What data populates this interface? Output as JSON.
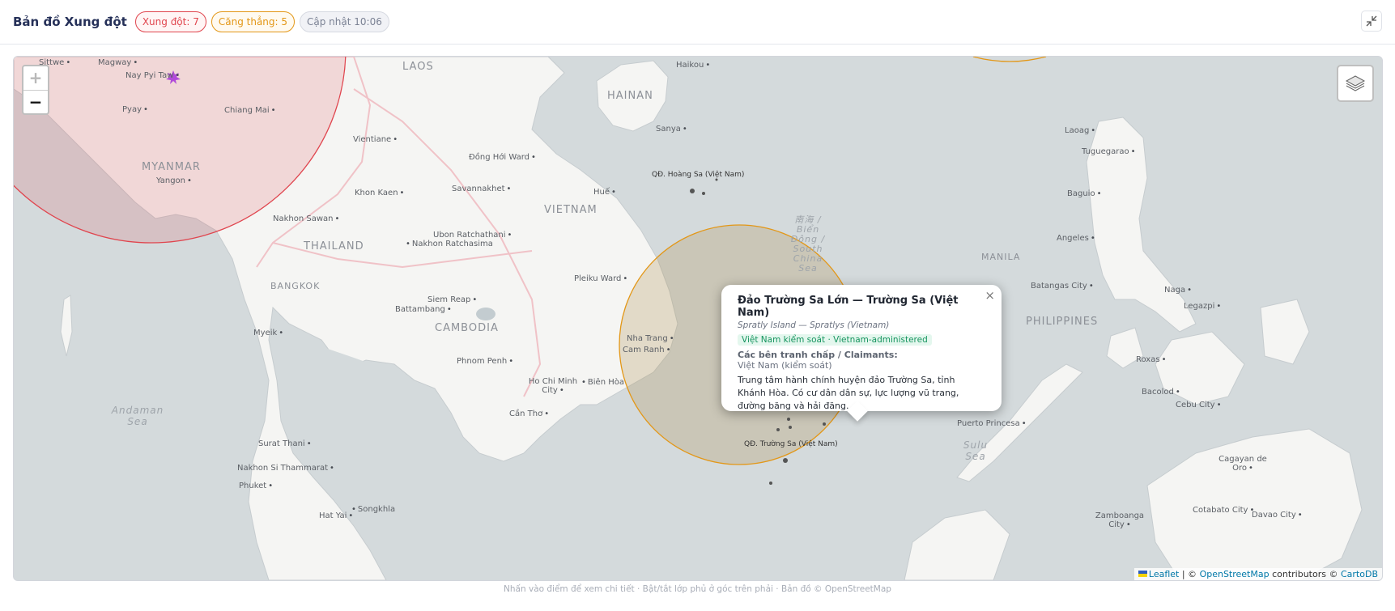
{
  "header": {
    "title": "Bản đồ Xung đột",
    "conflict_badge": "Xung đột: 7",
    "tension_badge": "Căng thẳng: 5",
    "update_badge": "Cập nhật 10:06"
  },
  "map": {
    "zoom_in": "+",
    "zoom_out": "−",
    "countries": {
      "laos": "LAOS",
      "hainan": "HAINAN",
      "myanmar": "MYANMAR",
      "vietnam": "VIETNAM",
      "thailand": "THAILAND",
      "cambodia": "CAMBODIA",
      "philippines": "PHILIPPINES",
      "manila": "MANILA",
      "bangkok": "BANGKOK"
    },
    "seas": {
      "andaman": "Andaman Sea",
      "sulu": "Sulu Sea",
      "scs": "南海 / Biển Đông / South China Sea"
    },
    "cities": {
      "sittwe": "Sittwe",
      "magway": "Magway",
      "naypyitaw": "Nay Pyi Taw",
      "pyay": "Pyay",
      "chiangmai": "Chiang Mai",
      "yangon": "Yangon",
      "vientiane": "Vientiane",
      "donghoi": "Đồng Hới Ward",
      "khonkaen": "Khon Kaen",
      "savannakhet": "Savannakhet",
      "hue": "Huế",
      "nakhonsawan": "Nakhon Sawan",
      "ubon": "Ubon Ratchathani",
      "nakhonratchasima": "Nakhon Ratchasima",
      "pleiku": "Pleiku Ward",
      "siemreap": "Siem Reap",
      "battambang": "Battambang",
      "myeik": "Myeik",
      "nhatrang": "Nha Trang",
      "camranh": "Cam Ranh",
      "phnompenh": "Phnom Penh",
      "hcm": "Ho Chi Minh City",
      "bienhoa": "Biên Hòa",
      "cantho": "Cần Thơ",
      "suratthani": "Surat Thani",
      "nakhonsi": "Nakhon Si Thammarat",
      "phuket": "Phuket",
      "songkhla": "Songkhla",
      "hatyai": "Hat Yai",
      "haikou": "Haikou",
      "sanya": "Sanya",
      "laoag": "Laoag",
      "tuguegarao": "Tuguegarao",
      "baguio": "Baguio",
      "angeles": "Angeles",
      "batangas": "Batangas City",
      "naga": "Naga",
      "legazpi": "Legazpi",
      "roxas": "Roxas",
      "bacolod": "Bacolod",
      "cebu": "Cebu City",
      "puertoprincesa": "Puerto Princesa",
      "cagayan": "Cagayan de Oro",
      "cotabato": "Cotabato City",
      "davao": "Davao City",
      "zamboanga": "Zamboanga City"
    },
    "archipelagos": {
      "paracel": "QĐ. Hoàng Sa (Việt Nam)",
      "spratly": "QĐ. Trường Sa (Việt Nam)"
    },
    "colors": {
      "conflict_zone": "#e0454e",
      "tension_zone": "#e39717",
      "sea": "#d4dadc",
      "land": "#f5f5f3"
    }
  },
  "popup": {
    "close": "×",
    "title": "Đảo Trường Sa Lớn — Trường Sa (Việt Nam)",
    "subtitle": "Spratly Island — Spratlys (Vietnam)",
    "status": "Việt Nam kiểm soát · Vietnam-administered",
    "claimants_heading": "Các bên tranh chấp / Claimants:",
    "claimants": "Việt Nam (kiểm soát)",
    "description": "Trung tâm hành chính huyện đảo Trường Sa, tỉnh Khánh Hòa. Có cư dân dân sự, lực lượng vũ trang, đường băng và hải đăng."
  },
  "attribution": {
    "leaflet": "Leaflet",
    "sep": " | © ",
    "osm": "OpenStreetMap",
    "mid": " contributors © ",
    "carto": "CartoDB"
  },
  "footer": "Nhấn vào điểm để xem chi tiết · Bật/tắt lớp phủ ở góc trên phải · Bản đồ © OpenStreetMap"
}
